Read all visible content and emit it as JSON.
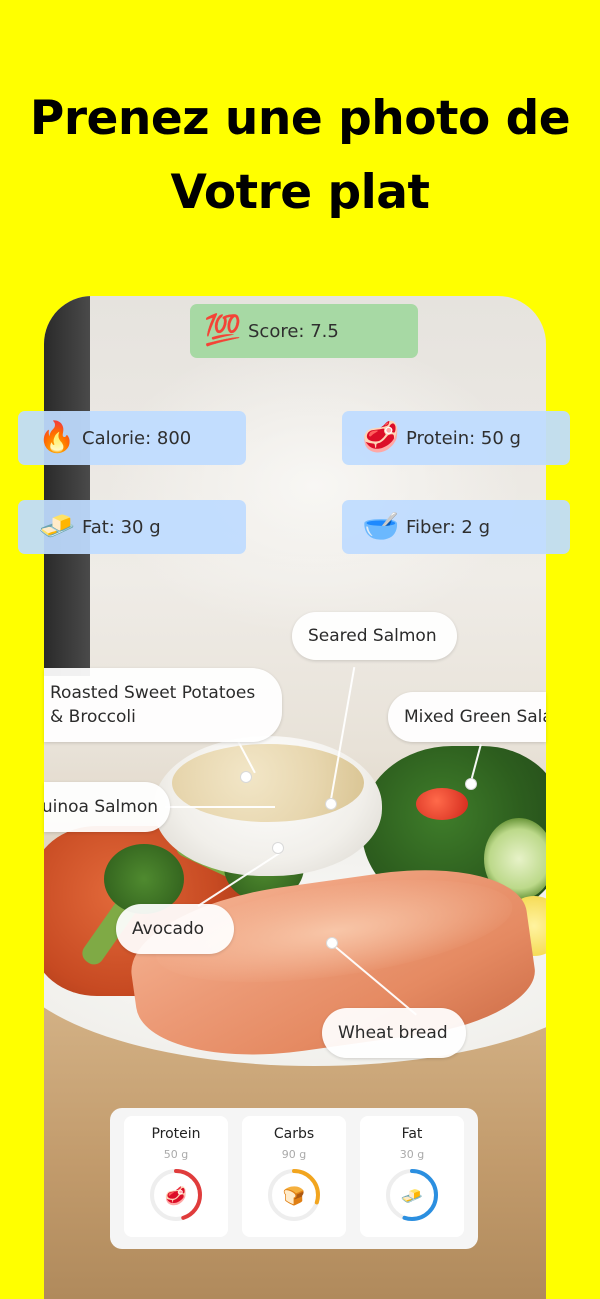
{
  "headline": {
    "line1": "Prenez une photo de",
    "line2": "Votre plat"
  },
  "score": {
    "icon": "hundred-points-icon",
    "glyph": "💯",
    "text": "Score: 7.5"
  },
  "nutrition_cards": [
    {
      "icon": "fire-icon",
      "glyph": "🔥",
      "text": "Calorie: 800"
    },
    {
      "icon": "meat-icon",
      "glyph": "🥩",
      "text": "Protein: 50 g"
    },
    {
      "icon": "butter-icon",
      "glyph": "🧈",
      "text": "Fat: 30 g"
    },
    {
      "icon": "bowl-icon",
      "glyph": "🥣",
      "text": "Fiber: 2 g"
    }
  ],
  "food_labels": {
    "seared_salmon": "Seared Salmon",
    "roasted_line1": "Roasted Sweet Potatoes",
    "roasted_line2": "& Broccoli",
    "mixed_green": "Mixed Green Salad",
    "quinoa_salmon": "Quinoa Salmon",
    "avocado": "Avocado",
    "wheat_bread": "Wheat bread"
  },
  "macros": [
    {
      "name": "Protein",
      "value": "50 g",
      "progress": 0.45,
      "color": "#e03c3c",
      "icon": "meat-icon",
      "glyph": "🥩"
    },
    {
      "name": "Carbs",
      "value": "90 g",
      "progress": 0.3,
      "color": "#f2a51e",
      "icon": "bread-icon",
      "glyph": "🍞"
    },
    {
      "name": "Fat",
      "value": "30 g",
      "progress": 0.55,
      "color": "#2b8fe0",
      "icon": "butter-icon",
      "glyph": "🧈"
    }
  ],
  "colors": {
    "background": "#ffff00",
    "card_blue": "#bedcff",
    "score_green": "#a7d9a4"
  }
}
